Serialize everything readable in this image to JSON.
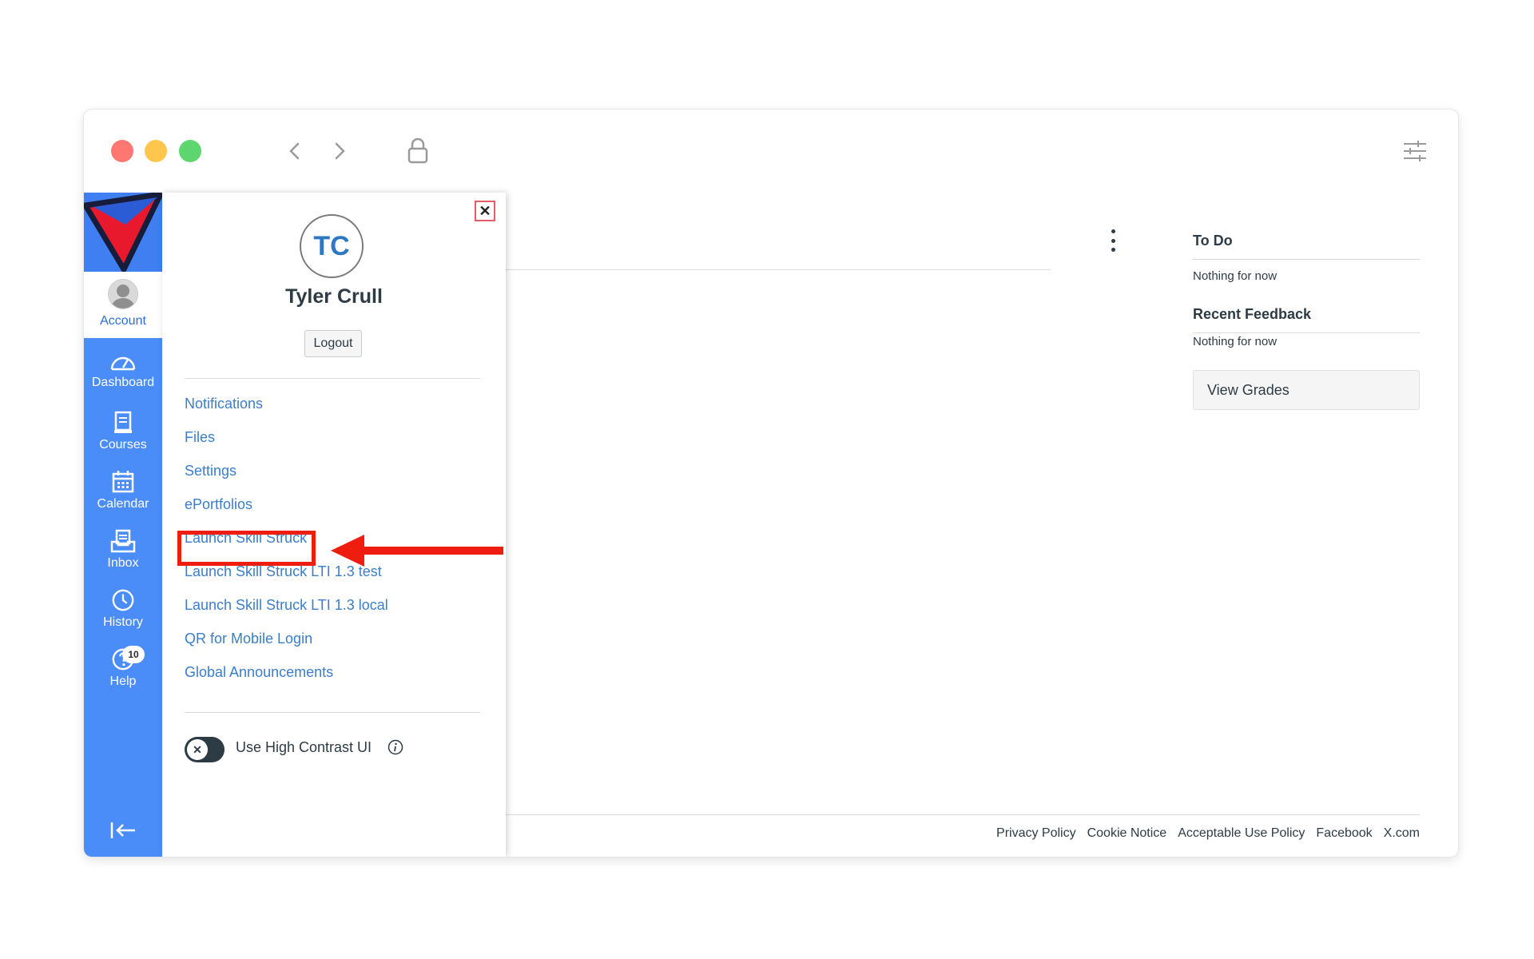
{
  "colors": {
    "nav_bg": "#4b8df8",
    "link": "#3b7ec9",
    "text": "#2d3b45",
    "highlight": "#ee1d10"
  },
  "browser": {
    "back_icon": "chevron-left-icon",
    "forward_icon": "chevron-right-icon",
    "lock_icon": "lock-icon",
    "settings_icon": "sliders-icon"
  },
  "global_nav": {
    "account_label": "Account",
    "items": [
      {
        "label": "Dashboard",
        "icon": "dashboard-icon"
      },
      {
        "label": "Courses",
        "icon": "courses-icon"
      },
      {
        "label": "Calendar",
        "icon": "calendar-icon"
      },
      {
        "label": "Inbox",
        "icon": "inbox-icon"
      },
      {
        "label": "History",
        "icon": "clock-icon"
      },
      {
        "label": "Help",
        "icon": "help-icon"
      }
    ],
    "help_badge": "10",
    "collapse_icon": "collapse-nav-icon"
  },
  "account_tray": {
    "initials": "TC",
    "name": "Tyler Crull",
    "logout_label": "Logout",
    "close_icon": "close-icon",
    "links": [
      "Notifications",
      "Files",
      "Settings",
      "ePortfolios",
      "Launch Skill Struck",
      "Launch Skill Struck LTI 1.3 test",
      "Launch Skill Struck LTI 1.3 local",
      "QR for Mobile Login",
      "Global Announcements"
    ],
    "high_contrast_label": "Use High Contrast UI",
    "high_contrast_on": false
  },
  "sidebar_right": {
    "todo_heading": "To Do",
    "todo_text": "Nothing for now",
    "feedback_heading": "Recent Feedback",
    "feedback_text": "Nothing for now",
    "view_grades_label": "View Grades"
  },
  "footer": {
    "links": [
      "Privacy Policy",
      "Cookie Notice",
      "Acceptable Use Policy",
      "Facebook",
      "X.com"
    ]
  }
}
